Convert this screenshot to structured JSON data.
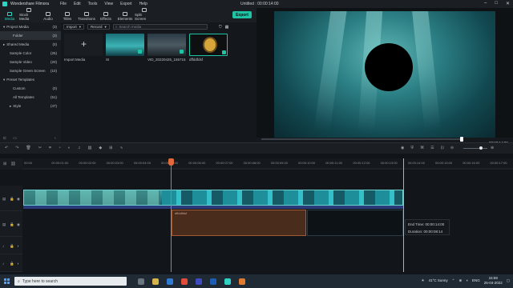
{
  "app": {
    "name": "Wondershare Filmora",
    "document_title": "Untitled : 00:00:14:00",
    "menu": [
      "File",
      "Edit",
      "Tools",
      "View",
      "Export",
      "Help"
    ]
  },
  "toolbar": {
    "tabs": [
      {
        "label": "Media",
        "active": true
      },
      {
        "label": "Stock Media",
        "active": false
      },
      {
        "label": "Audio",
        "active": false
      },
      {
        "label": "Titles",
        "active": false
      },
      {
        "label": "Transitions",
        "active": false
      },
      {
        "label": "Effects",
        "active": false
      },
      {
        "label": "Elements",
        "active": false
      },
      {
        "label": "Split Screen",
        "active": false
      }
    ],
    "export_label": "Export"
  },
  "sidebar": {
    "items": [
      {
        "label": "Project Media",
        "count": "(3)",
        "arrow": "▾",
        "selected": false
      },
      {
        "label": "Folder",
        "count": "(3)",
        "arrow": "",
        "selected": true
      },
      {
        "label": "Shared Media",
        "count": "(0)",
        "arrow": "▸",
        "selected": false
      },
      {
        "label": "Sample Color",
        "count": "(25)",
        "arrow": "",
        "selected": false
      },
      {
        "label": "Sample Video",
        "count": "(20)",
        "arrow": "",
        "selected": false
      },
      {
        "label": "Sample Green Screen",
        "count": "(10)",
        "arrow": "",
        "selected": false
      },
      {
        "label": "Preset Templates",
        "count": "",
        "arrow": "▾",
        "selected": false
      },
      {
        "label": "Custom",
        "count": "(0)",
        "arrow": "",
        "selected": false
      },
      {
        "label": "All Templates",
        "count": "(51)",
        "arrow": "",
        "selected": false
      },
      {
        "label": "Style",
        "count": "(47)",
        "arrow": "▸",
        "selected": false
      }
    ]
  },
  "media": {
    "import_label": "Import",
    "record_label": "Record",
    "search_placeholder": "Search media",
    "import_tile_label": "Import Media",
    "items": [
      {
        "label": "SI"
      },
      {
        "label": "VID_20220425_155715"
      },
      {
        "label": "dffddfdsf"
      }
    ]
  },
  "preview": {
    "timecode": "00:00:14:00",
    "quality": "Full"
  },
  "timeline": {
    "ruler": [
      "00:00",
      "00:00:01:00",
      "00:00:02:00",
      "00:00:03:00",
      "00:00:04:00",
      "00:00:05:00",
      "00:00:06:00",
      "00:00:07:00",
      "00:00:08:00",
      "00:00:09:00",
      "00:00:10:00",
      "00:00:11:00",
      "00:00:12:00",
      "00:00:13:00",
      "00:00:14:00",
      "00:00:15:00",
      "00:00:16:00",
      "00:00:17:00"
    ],
    "clip_label": "dffddfdsf",
    "tooltip": {
      "end_time": "End Time: 00:00:14:00",
      "duration": "Duration: 00:00:08:14"
    }
  },
  "taskbar": {
    "search_placeholder": "Type here to search",
    "weather": "41°C  Sunny",
    "lang": "ENG",
    "time": "15:59",
    "date": "25-04-2022"
  },
  "colors": {
    "accent": "#1fc4a4",
    "bg": "#111418",
    "playhead": "#e06a3a"
  }
}
